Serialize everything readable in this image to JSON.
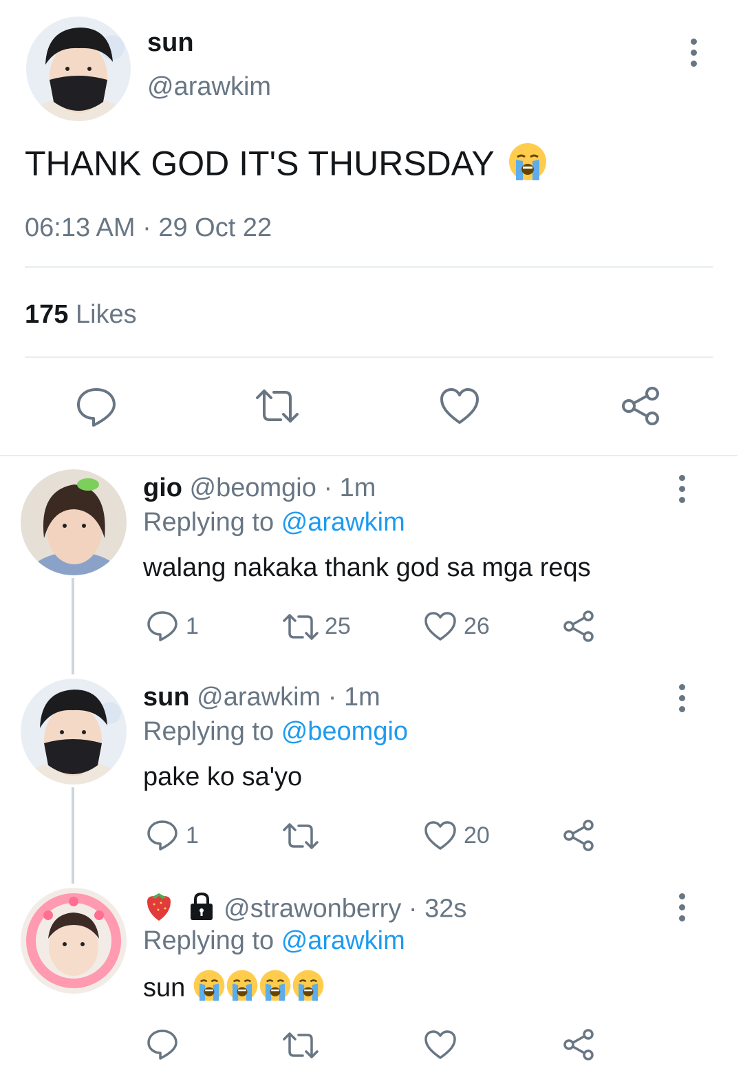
{
  "main_tweet": {
    "display_name": "sun",
    "handle": "@arawkim",
    "text": "THANK GOD IT'S THURSDAY",
    "time": "06:13 AM",
    "separator": "·",
    "date": "29 Oct 22",
    "likes_count": "175",
    "likes_label": "Likes"
  },
  "replies": [
    {
      "display_name": "gio",
      "handle": "@beomgio",
      "sep": "·",
      "time": "1m",
      "replying_prefix": "Replying to",
      "replying_to": "@arawkim",
      "text": "walang nakaka thank god sa mga reqs",
      "reply_count": "1",
      "retweet_count": "25",
      "like_count": "26"
    },
    {
      "display_name": "sun",
      "handle": "@arawkim",
      "sep": "·",
      "time": "1m",
      "replying_prefix": "Replying to",
      "replying_to": "@beomgio",
      "text": "pake ko sa'yo",
      "reply_count": "1",
      "retweet_count": "",
      "like_count": "20"
    },
    {
      "display_name": "",
      "handle": "@strawonberry",
      "sep": "·",
      "time": "32s",
      "replying_prefix": "Replying to",
      "replying_to": "@arawkim",
      "text": "sun",
      "reply_count": "",
      "retweet_count": "",
      "like_count": ""
    }
  ],
  "icons": [
    "more-vertical-icon",
    "reply-icon",
    "retweet-icon",
    "like-icon",
    "share-icon",
    "crying-emoji-icon",
    "strawberry-emoji-icon",
    "lock-icon"
  ],
  "colors": {
    "link": "#1d9bf0",
    "secondary": "#687684",
    "divider": "#e6ecf0",
    "thread": "#ccd6dd"
  }
}
